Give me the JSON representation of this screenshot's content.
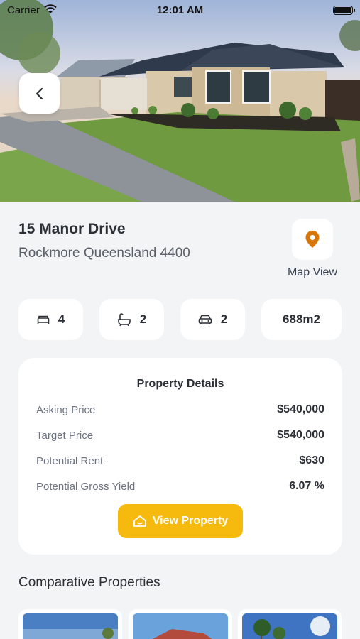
{
  "status_bar": {
    "carrier": "Carrier",
    "time": "12:01 AM"
  },
  "property": {
    "address": "15 Manor Drive",
    "suburb": "Rockmore Queensland 4400",
    "map_label": "Map View"
  },
  "features": [
    {
      "icon": "bed-icon",
      "value": "4"
    },
    {
      "icon": "bath-icon",
      "value": "2"
    },
    {
      "icon": "car-icon",
      "value": "2"
    },
    {
      "icon": "",
      "value": "688m2"
    }
  ],
  "details": {
    "title": "Property Details",
    "rows": [
      {
        "label": "Asking Price",
        "value": "$540,000"
      },
      {
        "label": "Target Price",
        "value": "$540,000"
      },
      {
        "label": "Potential Rent",
        "value": "$630"
      },
      {
        "label": "Potential Gross Yield",
        "value": "6.07 %"
      }
    ],
    "cta": "View Property"
  },
  "comparatives": {
    "title": "Comparative Properties"
  },
  "colors": {
    "accent": "#f6b90d",
    "map_pin": "#d97706",
    "background": "#f3f4f6"
  }
}
